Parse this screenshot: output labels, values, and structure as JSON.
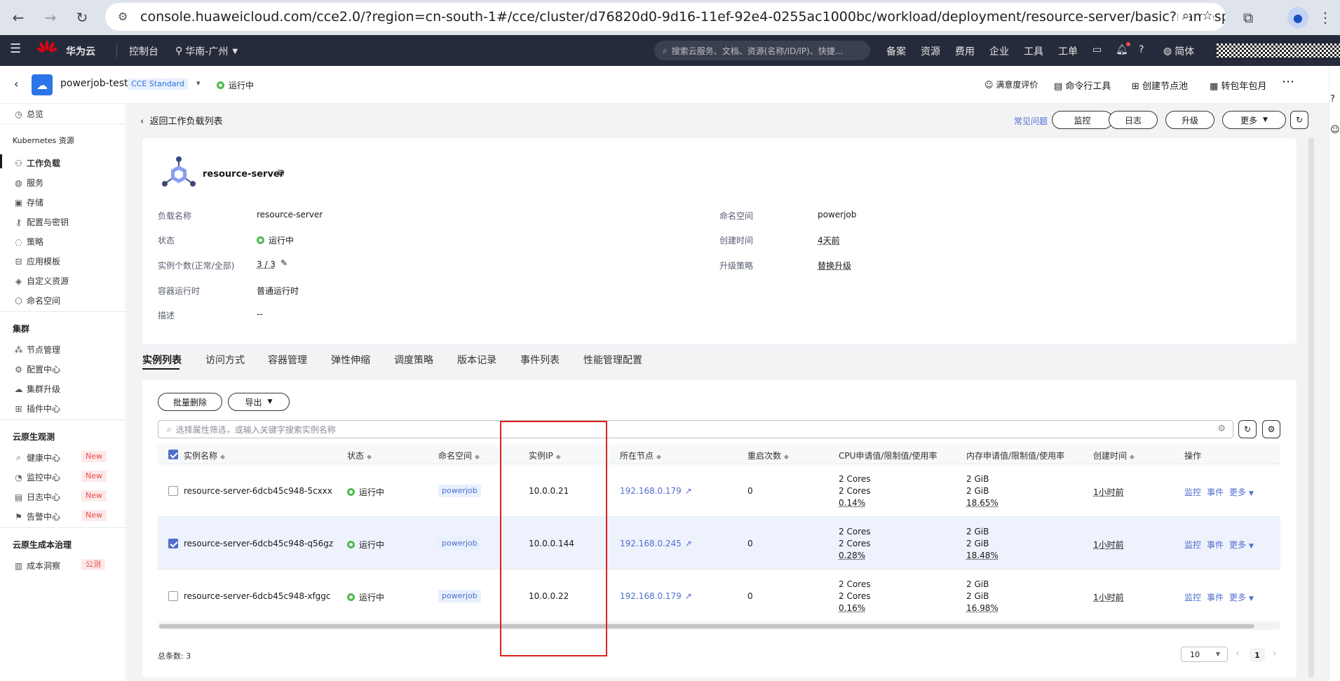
{
  "browser": {
    "url": "console.huaweicloud.com/cce2.0/?region=cn-south-1#/cce/cluster/d76820d0-9d16-11ef-92e4-0255ac1000bc/workload/deployment/resource-server/basic?namespace=po..."
  },
  "topnav": {
    "brand": "华为云",
    "console": "控制台",
    "region": "华南-广州",
    "search_placeholder": "搜索云服务、文档、资源(名称/ID/IP)、快捷...",
    "links": [
      "备案",
      "资源",
      "费用",
      "企业",
      "工具",
      "工单"
    ],
    "lang": "简体"
  },
  "cluster_header": {
    "name": "powerjob-test",
    "edition": "CCE Standard",
    "status": "运行中",
    "actions": [
      "满意度评价",
      "命令行工具",
      "创建节点池",
      "转包年包月"
    ]
  },
  "sidebar": {
    "overview": "总览",
    "k8s_title": "Kubernetes 资源",
    "k8s_items": [
      "工作负载",
      "服务",
      "存储",
      "配置与密钥",
      "策略",
      "应用模板",
      "自定义资源",
      "命名空间"
    ],
    "cluster_title": "集群",
    "cluster_items": [
      "节点管理",
      "配置中心",
      "集群升级",
      "插件中心"
    ],
    "observe_title": "云原生观测",
    "observe_items": [
      "健康中心",
      "监控中心",
      "日志中心",
      "告警中心"
    ],
    "new_tag": "New",
    "cost_title": "云原生成本治理",
    "cost_item": "成本洞察",
    "beta_tag": "公测"
  },
  "page": {
    "back_label": "返回工作负载列表",
    "faq": "常见问题",
    "buttons": [
      "监控",
      "日志",
      "升级",
      "更多"
    ]
  },
  "workload": {
    "name": "resource-server",
    "fields_left": [
      {
        "label": "负载名称",
        "value": "resource-server"
      },
      {
        "label": "状态",
        "value": "运行中"
      },
      {
        "label": "实例个数(正常/全部)",
        "value": "3 / 3"
      },
      {
        "label": "容器运行时",
        "value": "普通运行时"
      },
      {
        "label": "描述",
        "value": "--"
      }
    ],
    "fields_right": [
      {
        "label": "命名空间",
        "value": "powerjob"
      },
      {
        "label": "创建时间",
        "value": "4天前"
      },
      {
        "label": "升级策略",
        "value": "替换升级"
      }
    ]
  },
  "tabs": [
    "实例列表",
    "访问方式",
    "容器管理",
    "弹性伸缩",
    "调度策略",
    "版本记录",
    "事件列表",
    "性能管理配置"
  ],
  "toolbar": {
    "batch_delete": "批量删除",
    "export": "导出",
    "filter_placeholder": "选择属性筛选，或输入关键字搜索实例名称"
  },
  "table": {
    "columns": [
      "实例名称",
      "状态",
      "命名空间",
      "实例IP",
      "所在节点",
      "重启次数",
      "CPU申请值/限制值/使用率",
      "内存申请值/限制值/使用率",
      "创建时间",
      "操作"
    ],
    "rows": [
      {
        "name": "resource-server-6dcb45c948-5cxxx",
        "status": "运行中",
        "namespace": "powerjob",
        "ip": "10.0.0.21",
        "node": "192.168.0.179",
        "restarts": "0",
        "cpu_req": "2 Cores",
        "cpu_lim": "2 Cores",
        "cpu_use": "0.14%",
        "mem_req": "2 GiB",
        "mem_lim": "2 GiB",
        "mem_use": "18.65%",
        "created": "1小时前",
        "checked": false
      },
      {
        "name": "resource-server-6dcb45c948-q56gz",
        "status": "运行中",
        "namespace": "powerjob",
        "ip": "10.0.0.144",
        "node": "192.168.0.245",
        "restarts": "0",
        "cpu_req": "2 Cores",
        "cpu_lim": "2 Cores",
        "cpu_use": "0.28%",
        "mem_req": "2 GiB",
        "mem_lim": "2 GiB",
        "mem_use": "18.48%",
        "created": "1小时前",
        "checked": true
      },
      {
        "name": "resource-server-6dcb45c948-xfggc",
        "status": "运行中",
        "namespace": "powerjob",
        "ip": "10.0.0.22",
        "node": "192.168.0.179",
        "restarts": "0",
        "cpu_req": "2 Cores",
        "cpu_lim": "2 Cores",
        "cpu_use": "0.16%",
        "mem_req": "2 GiB",
        "mem_lim": "2 GiB",
        "mem_use": "16.98%",
        "created": "1小时前",
        "checked": false
      }
    ],
    "ops": [
      "监控",
      "事件",
      "更多"
    ]
  },
  "footer": {
    "total": "总条数: 3",
    "page_size": "10",
    "page": "1"
  },
  "colors": {
    "accent": "#526ecc",
    "highlight": "#e02020",
    "running": "#50b84d"
  }
}
